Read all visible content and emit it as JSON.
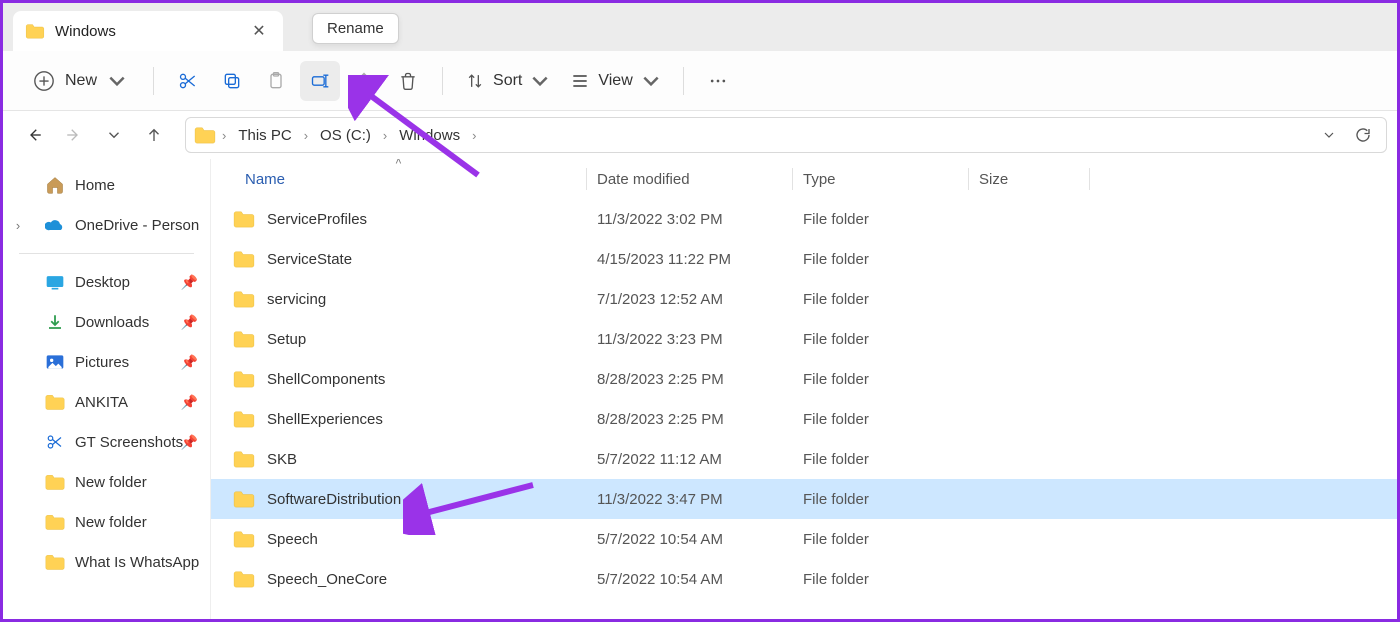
{
  "tab": {
    "title": "Windows"
  },
  "tooltip": {
    "rename": "Rename"
  },
  "toolbar": {
    "new_label": "New",
    "sort_label": "Sort",
    "view_label": "View"
  },
  "breadcrumbs": {
    "items": [
      "This PC",
      "OS (C:)",
      "Windows"
    ]
  },
  "sidebar": {
    "home": "Home",
    "onedrive": "OneDrive - Person",
    "quick": [
      {
        "label": "Desktop",
        "pinned": true,
        "icon": "desktop"
      },
      {
        "label": "Downloads",
        "pinned": true,
        "icon": "downloads"
      },
      {
        "label": "Pictures",
        "pinned": true,
        "icon": "pictures"
      },
      {
        "label": "ANKITA",
        "pinned": true,
        "icon": "folder"
      },
      {
        "label": "GT Screenshots",
        "pinned": true,
        "icon": "scissors"
      },
      {
        "label": "New folder",
        "pinned": false,
        "icon": "folder"
      },
      {
        "label": "New folder",
        "pinned": false,
        "icon": "folder"
      },
      {
        "label": "What Is WhatsApp",
        "pinned": false,
        "icon": "folder"
      }
    ]
  },
  "columns": {
    "name": "Name",
    "date": "Date modified",
    "type": "Type",
    "size": "Size"
  },
  "rows": [
    {
      "name": "ServiceProfiles",
      "date": "11/3/2022 3:02 PM",
      "type": "File folder",
      "selected": false
    },
    {
      "name": "ServiceState",
      "date": "4/15/2023 11:22 PM",
      "type": "File folder",
      "selected": false
    },
    {
      "name": "servicing",
      "date": "7/1/2023 12:52 AM",
      "type": "File folder",
      "selected": false
    },
    {
      "name": "Setup",
      "date": "11/3/2022 3:23 PM",
      "type": "File folder",
      "selected": false
    },
    {
      "name": "ShellComponents",
      "date": "8/28/2023 2:25 PM",
      "type": "File folder",
      "selected": false
    },
    {
      "name": "ShellExperiences",
      "date": "8/28/2023 2:25 PM",
      "type": "File folder",
      "selected": false
    },
    {
      "name": "SKB",
      "date": "5/7/2022 11:12 AM",
      "type": "File folder",
      "selected": false
    },
    {
      "name": "SoftwareDistribution",
      "date": "11/3/2022 3:47 PM",
      "type": "File folder",
      "selected": true
    },
    {
      "name": "Speech",
      "date": "5/7/2022 10:54 AM",
      "type": "File folder",
      "selected": false
    },
    {
      "name": "Speech_OneCore",
      "date": "5/7/2022 10:54 AM",
      "type": "File folder",
      "selected": false
    }
  ]
}
